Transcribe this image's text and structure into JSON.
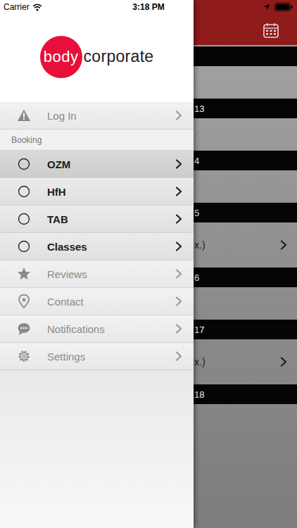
{
  "status_bar": {
    "carrier": "Carrier",
    "time": "3:18 PM"
  },
  "logo": {
    "circle_text": "body",
    "text": "corporate"
  },
  "menu": [
    {
      "label": "Log In",
      "kind": "link",
      "selected": false
    },
    {
      "label": "Booking",
      "kind": "header",
      "selected": false
    },
    {
      "label": "OZM",
      "kind": "booking",
      "selected": true,
      "checked": false
    },
    {
      "label": "HfH",
      "kind": "booking",
      "selected": false,
      "checked": false
    },
    {
      "label": "TAB",
      "kind": "booking",
      "selected": false,
      "checked": false
    },
    {
      "label": "Classes",
      "kind": "booking",
      "selected": false,
      "checked": false
    },
    {
      "label": "Reviews",
      "kind": "link",
      "selected": false
    },
    {
      "label": "Contact",
      "kind": "link",
      "selected": false
    },
    {
      "label": "Notifications",
      "kind": "link",
      "selected": false
    },
    {
      "label": "Settings",
      "kind": "link",
      "selected": false
    }
  ],
  "days": [
    {
      "label": "",
      "kind": "empty",
      "entry": ""
    },
    {
      "label": "13",
      "kind": "empty",
      "entry": ""
    },
    {
      "label": "4",
      "kind": "empty",
      "entry": ""
    },
    {
      "label": "5",
      "kind": "entry",
      "entry": "x.)"
    },
    {
      "label": "6",
      "kind": "empty",
      "entry": ""
    },
    {
      "label": "17",
      "kind": "entry",
      "entry": "x.)"
    },
    {
      "label": "18",
      "kind": "empty",
      "entry": ""
    }
  ]
}
